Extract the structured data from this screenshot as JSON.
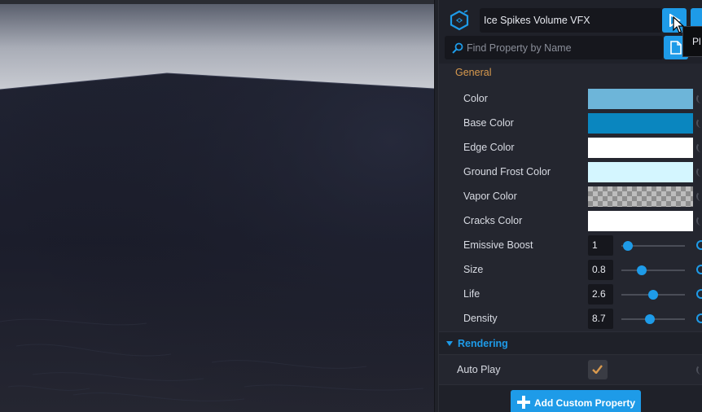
{
  "header": {
    "title": "Ice Spikes Volume VFX",
    "search_placeholder": "Find Property by Name",
    "tooltip": "Pl",
    "icons": {
      "vfx": "vfx-hex-icon",
      "play": "play-icon",
      "search": "search-icon",
      "copy": "copy-icon",
      "cursor": "mouse-cursor-icon"
    }
  },
  "sections": {
    "general": "General",
    "rendering": "Rendering"
  },
  "colors": {
    "accent": "#1e9be8",
    "section_orange": "#d99a4e"
  },
  "color_props": [
    {
      "label": "Color",
      "color": "#6db5d9"
    },
    {
      "label": "Base Color",
      "color": "#0a86bf"
    },
    {
      "label": "Edge Color",
      "color": "#ffffff"
    },
    {
      "label": "Ground Frost Color",
      "color": "#d4f6ff"
    },
    {
      "label": "Vapor Color",
      "color": "transparent"
    },
    {
      "label": "Cracks Color",
      "color": "#ffffff"
    }
  ],
  "number_props": [
    {
      "label": "Emissive Boost",
      "value": "1",
      "level": 0.1
    },
    {
      "label": "Size",
      "value": "0.8",
      "level": 0.32
    },
    {
      "label": "Life",
      "value": "2.6",
      "level": 0.5
    },
    {
      "label": "Density",
      "value": "8.7",
      "level": 0.45
    }
  ],
  "auto_play": {
    "label": "Auto Play",
    "checked": true
  },
  "footer": {
    "add_label": "Add Custom Property"
  }
}
